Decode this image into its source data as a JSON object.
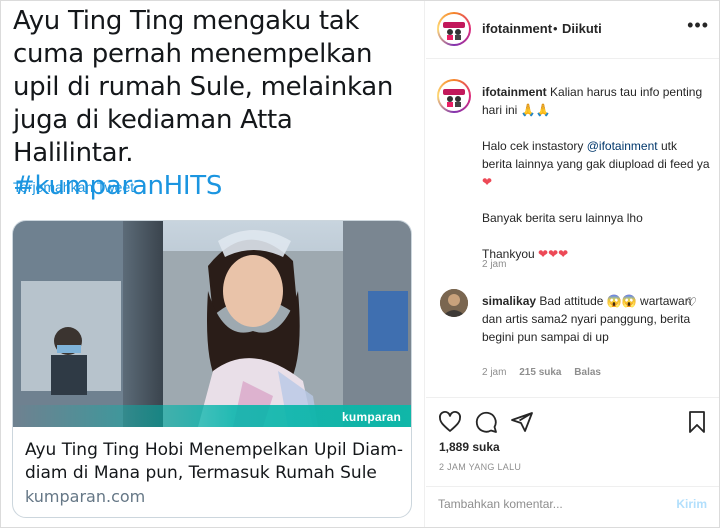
{
  "tweet": {
    "text": "Ayu Ting Ting mengaku tak cuma pernah menempelkan upil di rumah Sule, melainkan juga di kediaman Atta Halilintar.",
    "hashtag": "#kumparanHITS",
    "translate_label": "Terjemahkan Tweet",
    "card": {
      "brand": "kumparan",
      "title": "Ayu Ting Ting Hobi Menempelkan Upil Diam-diam di Mana pun, Termasuk Rumah Sule",
      "domain": "kumparan.com"
    }
  },
  "post": {
    "header": {
      "username": "ifotainment",
      "separator": "•",
      "follow_status": "Diikuti",
      "more_icon": "more-horizontal-icon"
    },
    "caption": {
      "username": "ifotainment",
      "line1": "Kalian harus tau info penting hari ini",
      "line1_emoji": "🙏🙏",
      "line2_prefix": "Halo cek instastory",
      "line2_mention": "@ifotainment",
      "line2_suffix": "utk berita lainnya yang gak diupload di feed ya",
      "line2_emoji": "❤",
      "line3": "Banyak berita seru lainnya lho",
      "line4": "Thankyou",
      "line4_emoji": "❤❤❤",
      "time": "2 jam"
    },
    "comment": {
      "username": "simalikay",
      "text_a": "Bad attitude",
      "emoji": "😱😱",
      "text_b": "wartawan dan artis sama2 nyari panggung, berita begini pun sampai di up",
      "time": "2 jam",
      "likes": "215 suka",
      "reply": "Balas",
      "like_icon": "heart-outline-icon"
    },
    "likes_count": "1,889 suka",
    "time_ago": "2 JAM YANG LALU",
    "comment_placeholder": "Tambahkan komentar...",
    "post_button": "Kirim",
    "colors": {
      "link": "#1b95e0",
      "mention": "#00376b",
      "heart": "#ed4956",
      "post_disabled": "#b2dffc"
    }
  }
}
